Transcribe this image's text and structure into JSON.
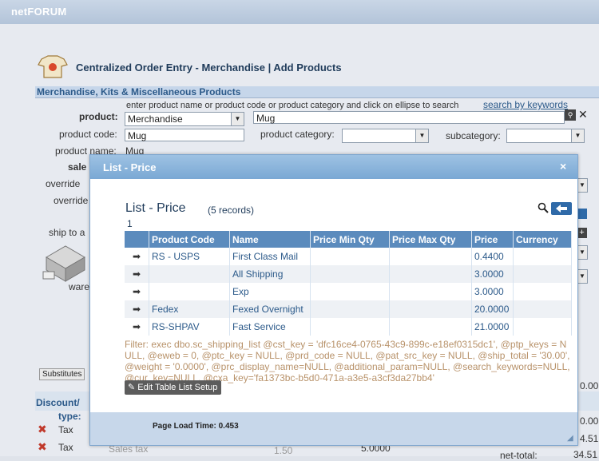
{
  "app": {
    "brand": "netFORUM"
  },
  "page": {
    "title": "Centralized Order Entry - Merchandise | Add Products",
    "section_title": "Merchandise, Kits & Miscellaneous Products",
    "hint": "enter product name or product code or product category and click on ellipse to search",
    "search_keywords_link": "search by keywords",
    "product_label": "product:",
    "product_select": "Merchandise",
    "product_search": "Mug",
    "product_code_label": "product code:",
    "product_code": "Mug",
    "product_category_label": "product category:",
    "subcategory_label": "subcategory:",
    "product_name_label": "product name:",
    "product_name": "Mug",
    "sale_label": "sale",
    "override_label_1": "override",
    "override_label_2": "override",
    "ship_to_label": "ship to a",
    "warehouse_label": "ware",
    "substitutes_label": "Substitutes",
    "discount_label": "Discount/",
    "type_label": "type:",
    "tax_rows": [
      {
        "label": "Tax"
      },
      {
        "label": "Tax",
        "desc": "Sales tax",
        "qty": "1.50",
        "amount": "5.0000"
      }
    ],
    "net_total_label": "net-total:",
    "right_values": [
      "0.00",
      "0.00",
      "4.51",
      "34.51"
    ]
  },
  "modal": {
    "title": "List - Price",
    "list_title": "List - Price",
    "record_count": "(5 records)",
    "page_number": "1",
    "columns": [
      "Product Code",
      "Name",
      "Price Min Qty",
      "Price Max Qty",
      "Price",
      "Currency"
    ],
    "rows": [
      {
        "code": "RS - USPS",
        "name": "First Class Mail",
        "min": "",
        "max": "",
        "price": "0.4400",
        "currency": ""
      },
      {
        "code": "",
        "name": "All Shipping",
        "min": "",
        "max": "",
        "price": "3.0000",
        "currency": ""
      },
      {
        "code": "",
        "name": "Exp",
        "min": "",
        "max": "",
        "price": "3.0000",
        "currency": ""
      },
      {
        "code": "Fedex",
        "name": "Fexed Overnight",
        "min": "",
        "max": "",
        "price": "20.0000",
        "currency": ""
      },
      {
        "code": "RS-SHPAV",
        "name": "Fast Service",
        "min": "",
        "max": "",
        "price": "21.0000",
        "currency": ""
      }
    ],
    "filter_text": "Filter: exec dbo.sc_shipping_list @cst_key = 'dfc16ce4-0765-43c9-899c-e18ef0315dc1', @ptp_keys = NULL, @eweb = 0, @ptc_key = NULL, @prd_code = NULL, @pat_src_key = NULL, @ship_total = '30.00', @weight = '0.0000', @prc_display_name=NULL, @additional_param=NULL, @search_keywords=NULL, @cur_key=NULL, @cxa_key='fa1373bc-b5d0-471a-a3e5-a3cf3da27bb4'",
    "edit_button": "Edit Table List Setup",
    "load_time": "Page Load Time: 0.453",
    "close_glyph": "×"
  },
  "colors": {
    "header_blue": "#5b8bbd",
    "accent": "#2c5a8a",
    "filter_text": "#b8926a"
  }
}
